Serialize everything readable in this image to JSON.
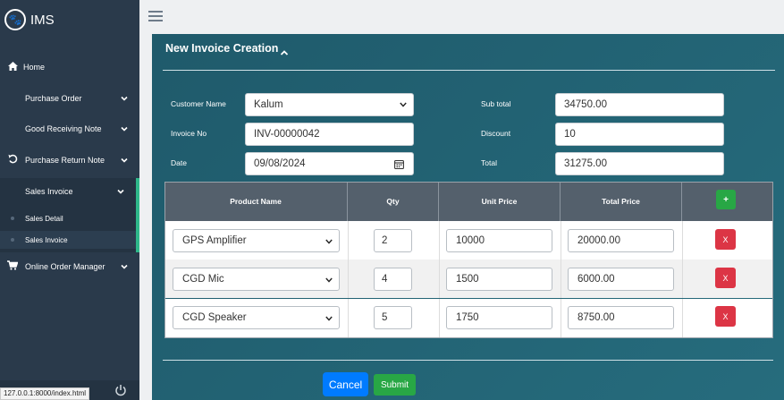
{
  "brand": {
    "name": "IMS",
    "logo_icon": "paw-icon"
  },
  "sidebar": {
    "items": [
      {
        "label": "Home",
        "icon": "home-icon"
      },
      {
        "label": "Purchase Order"
      },
      {
        "label": "Good Receiving Note"
      },
      {
        "label": "Purchase Return Note",
        "icon": "undo-icon"
      },
      {
        "label": "Sales Invoice"
      },
      {
        "label": "Online Order Manager",
        "icon": "cart-icon"
      }
    ],
    "sub_items": [
      {
        "label": "Sales Detail"
      },
      {
        "label": "Sales Invoice"
      }
    ]
  },
  "status_bar": {
    "url": "127.0.0.1:8000/index.html"
  },
  "form": {
    "title": "New Invoice Creation",
    "customer_name": {
      "label": "Customer Name",
      "value": "Kalum"
    },
    "invoice_no": {
      "label": "Invoice No",
      "value": "INV-00000042"
    },
    "date": {
      "label": "Date",
      "value": "09/08/2024"
    },
    "sub_total": {
      "label": "Sub total",
      "value": "34750.00"
    },
    "discount": {
      "label": "Discount",
      "value": "10"
    },
    "total": {
      "label": "Total",
      "value": "31275.00"
    }
  },
  "table": {
    "headers": [
      "Product Name",
      "Qty",
      "Unit Price",
      "Total Price"
    ],
    "add_label": "+",
    "delete_label": "X",
    "rows": [
      {
        "product": "GPS Amplifier",
        "qty": "2",
        "unit_price": "10000",
        "total_price": "20000.00"
      },
      {
        "product": "CGD Mic",
        "qty": "4",
        "unit_price": "1500",
        "total_price": "6000.00"
      },
      {
        "product": "CGD Speaker",
        "qty": "5",
        "unit_price": "1750",
        "total_price": "8750.00"
      }
    ]
  },
  "actions": {
    "cancel_label": "Cancel",
    "submit_label": "Submit"
  },
  "colors": {
    "sidebar_bg": "#2a3a4b",
    "card_bg": "#215f72",
    "accent": "#2eb88a",
    "primary": "#007bff",
    "success": "#28a745",
    "danger": "#dc3545"
  }
}
